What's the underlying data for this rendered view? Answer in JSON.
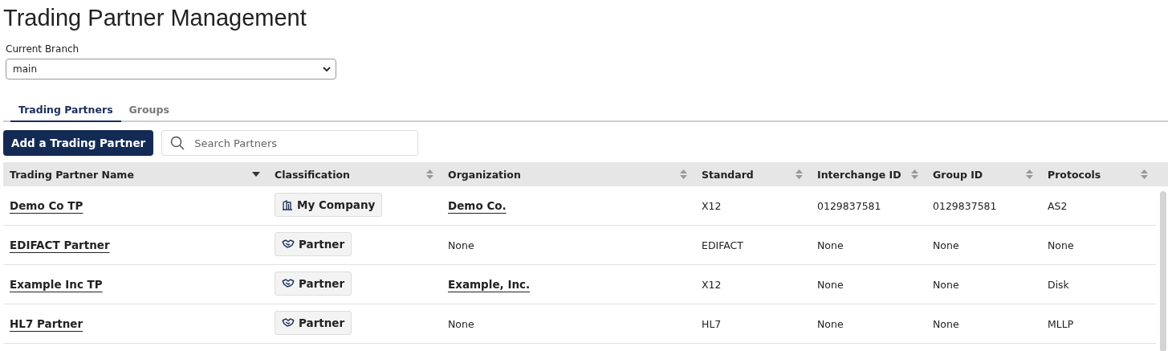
{
  "title": "Trading Partner Management",
  "branch": {
    "label": "Current Branch",
    "value": "main"
  },
  "tabs": [
    {
      "label": "Trading Partners",
      "selected": true
    },
    {
      "label": "Groups",
      "selected": false
    }
  ],
  "add_button": "Add a Trading Partner",
  "search": {
    "placeholder": "Search Partners"
  },
  "table": {
    "columns": [
      {
        "label": "Trading Partner Name",
        "sorted": true
      },
      {
        "label": "Classification",
        "sorted": false
      },
      {
        "label": "Organization",
        "sorted": false
      },
      {
        "label": "Standard",
        "sorted": false
      },
      {
        "label": "Interchange ID",
        "sorted": false
      },
      {
        "label": "Group ID",
        "sorted": false
      },
      {
        "label": "Protocols",
        "sorted": false
      }
    ],
    "rows": [
      {
        "name": "Demo Co TP",
        "classification": {
          "kind": "company",
          "label": "My Company"
        },
        "organization": {
          "kind": "link",
          "text": "Demo Co."
        },
        "standard": "X12",
        "interchange_id": "0129837581",
        "group_id": "0129837581",
        "protocols": "AS2"
      },
      {
        "name": "EDIFACT Partner",
        "classification": {
          "kind": "partner",
          "label": "Partner"
        },
        "organization": {
          "kind": "text",
          "text": "None"
        },
        "standard": "EDIFACT",
        "interchange_id": "None",
        "group_id": "None",
        "protocols": "None"
      },
      {
        "name": "Example Inc TP",
        "classification": {
          "kind": "partner",
          "label": "Partner"
        },
        "organization": {
          "kind": "link",
          "text": "Example, Inc."
        },
        "standard": "X12",
        "interchange_id": "None",
        "group_id": "None",
        "protocols": "Disk"
      },
      {
        "name": "HL7 Partner",
        "classification": {
          "kind": "partner",
          "label": "Partner"
        },
        "organization": {
          "kind": "text",
          "text": "None"
        },
        "standard": "HL7",
        "interchange_id": "None",
        "group_id": "None",
        "protocols": "MLLP"
      }
    ]
  }
}
